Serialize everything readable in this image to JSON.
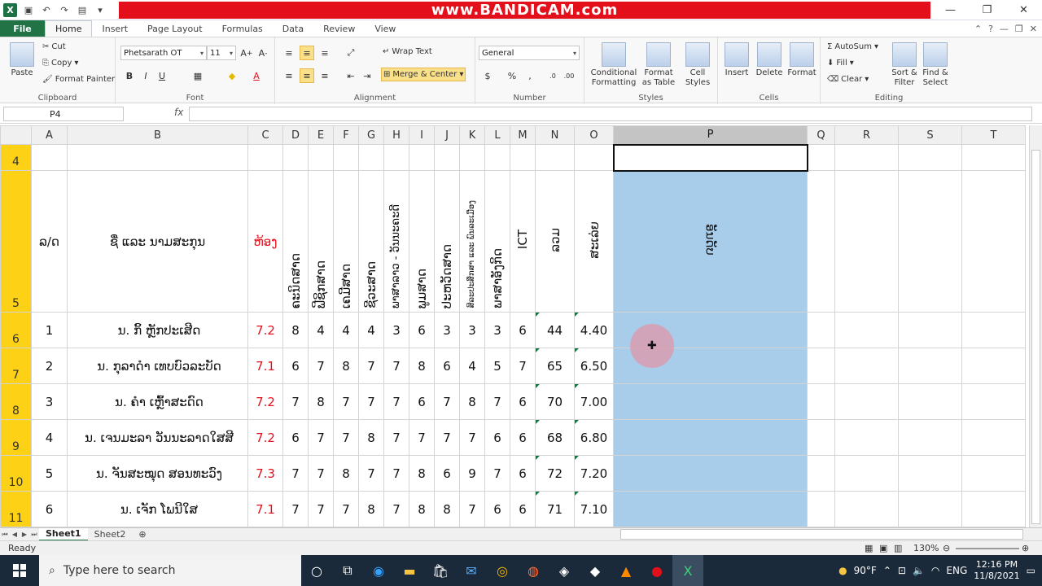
{
  "window": {
    "watermark": "www.BANDICAM.com",
    "controls": {
      "minimize": "—",
      "restore": "❐",
      "close": "✕"
    }
  },
  "ribbon_tabs": {
    "file": "File",
    "tabs": [
      "Home",
      "Insert",
      "Page Layout",
      "Formulas",
      "Data",
      "Review",
      "View"
    ],
    "active": "Home"
  },
  "ribbon": {
    "clipboard": {
      "paste": "Paste",
      "cut": "Cut",
      "copy": "Copy",
      "format_painter": "Format Painter",
      "label": "Clipboard"
    },
    "font": {
      "name": "Phetsarath OT",
      "size": "11",
      "label": "Font",
      "bold": "B",
      "italic": "I",
      "underline": "U"
    },
    "alignment": {
      "wrap_text": "Wrap Text",
      "merge_center": "Merge & Center",
      "label": "Alignment"
    },
    "number": {
      "format": "General",
      "currency": "$",
      "percent": "%",
      "comma": ",",
      "label": "Number"
    },
    "styles": {
      "conditional": "Conditional\nFormatting",
      "format_table": "Format\nas Table",
      "cell_styles": "Cell\nStyles",
      "label": "Styles"
    },
    "cells": {
      "insert": "Insert",
      "delete": "Delete",
      "format": "Format",
      "label": "Cells"
    },
    "editing": {
      "autosum": "AutoSum",
      "fill": "Fill",
      "clear": "Clear",
      "sort_filter": "Sort &\nFilter",
      "find_select": "Find &\nSelect",
      "label": "Editing"
    }
  },
  "formula_bar": {
    "name_box": "P4",
    "fx": "fx",
    "value": ""
  },
  "columns": [
    "A",
    "B",
    "C",
    "D",
    "E",
    "F",
    "G",
    "H",
    "I",
    "J",
    "K",
    "L",
    "M",
    "N",
    "O",
    "P",
    "Q",
    "R",
    "S",
    "T"
  ],
  "header_row": {
    "row_num": "5",
    "no": "ລ/ດ",
    "name": "ຊື່ ແລະ ນາມສະກຸນ",
    "class": "ຫ້ອງ",
    "subjects": [
      "ຄະນິດສາດ",
      "ຟີຊິກສາດ",
      "ເຄມີສາດ",
      "ຊີວະສາດ",
      "ພາສາລາວ - ວັນນະຄະດີ",
      "ພູມສາດ",
      "ປະຫວັດສາດ",
      "ສິລະປະສຶກສາ ແລະ ພົນລະເມືອງ",
      "ພາສາອັງກິດ",
      "ICT"
    ],
    "total": "ລວມ",
    "average": "ສະເລ່ຍ",
    "rank": "ອັນດັບ"
  },
  "rows": [
    {
      "row_num": "6",
      "no": "1",
      "name": "ນ. ກິ້ ຫຼັກປະເສີດ",
      "class": "7.2",
      "scores": [
        "8",
        "4",
        "4",
        "4",
        "3",
        "6",
        "3",
        "3",
        "3",
        "6"
      ],
      "total": "44",
      "average": "4.40"
    },
    {
      "row_num": "7",
      "no": "2",
      "name": "ນ. ກຸລາດໍາ ເທບບົວລະບັດ",
      "class": "7.1",
      "scores": [
        "6",
        "7",
        "8",
        "7",
        "7",
        "8",
        "6",
        "4",
        "5",
        "7"
      ],
      "total": "65",
      "average": "6.50"
    },
    {
      "row_num": "8",
      "no": "3",
      "name": "ນ. ຄໍາ ເຫຼົ້າສະດົດ",
      "class": "7.2",
      "scores": [
        "7",
        "8",
        "7",
        "7",
        "7",
        "6",
        "7",
        "8",
        "7",
        "6"
      ],
      "total": "70",
      "average": "7.00"
    },
    {
      "row_num": "9",
      "no": "4",
      "name": "ນ. ເຈນມະລາ ວັນນະລາດໃສສີ",
      "class": "7.2",
      "scores": [
        "6",
        "7",
        "7",
        "8",
        "7",
        "7",
        "7",
        "7",
        "6",
        "6"
      ],
      "total": "68",
      "average": "6.80"
    },
    {
      "row_num": "10",
      "no": "5",
      "name": "ນ. ຈັນສະໝຸດ ສອນທະວົງ",
      "class": "7.3",
      "scores": [
        "7",
        "7",
        "8",
        "7",
        "7",
        "8",
        "6",
        "9",
        "7",
        "6"
      ],
      "total": "72",
      "average": "7.20"
    },
    {
      "row_num": "11",
      "no": "6",
      "name": "ນ. ເຈັກ ໂພນີໃສ",
      "class": "7.1",
      "scores": [
        "7",
        "7",
        "7",
        "8",
        "7",
        "8",
        "8",
        "7",
        "6",
        "6"
      ],
      "total": "71",
      "average": "7.10"
    }
  ],
  "row4_num": "4",
  "sheet_tabs": [
    "Sheet1",
    "Sheet2"
  ],
  "status": {
    "ready": "Ready",
    "zoom": "130%"
  },
  "taskbar": {
    "search_placeholder": "Type here to search",
    "weather": "90°F",
    "lang": "ENG",
    "time": "12:16 PM",
    "date": "11/8/2021"
  },
  "colors": {
    "excel_green": "#217346",
    "row_header_yellow": "#fcd116",
    "selection_blue": "#a7cdeb",
    "class_red": "#e3101c",
    "bandicam_red": "#e3101c"
  }
}
